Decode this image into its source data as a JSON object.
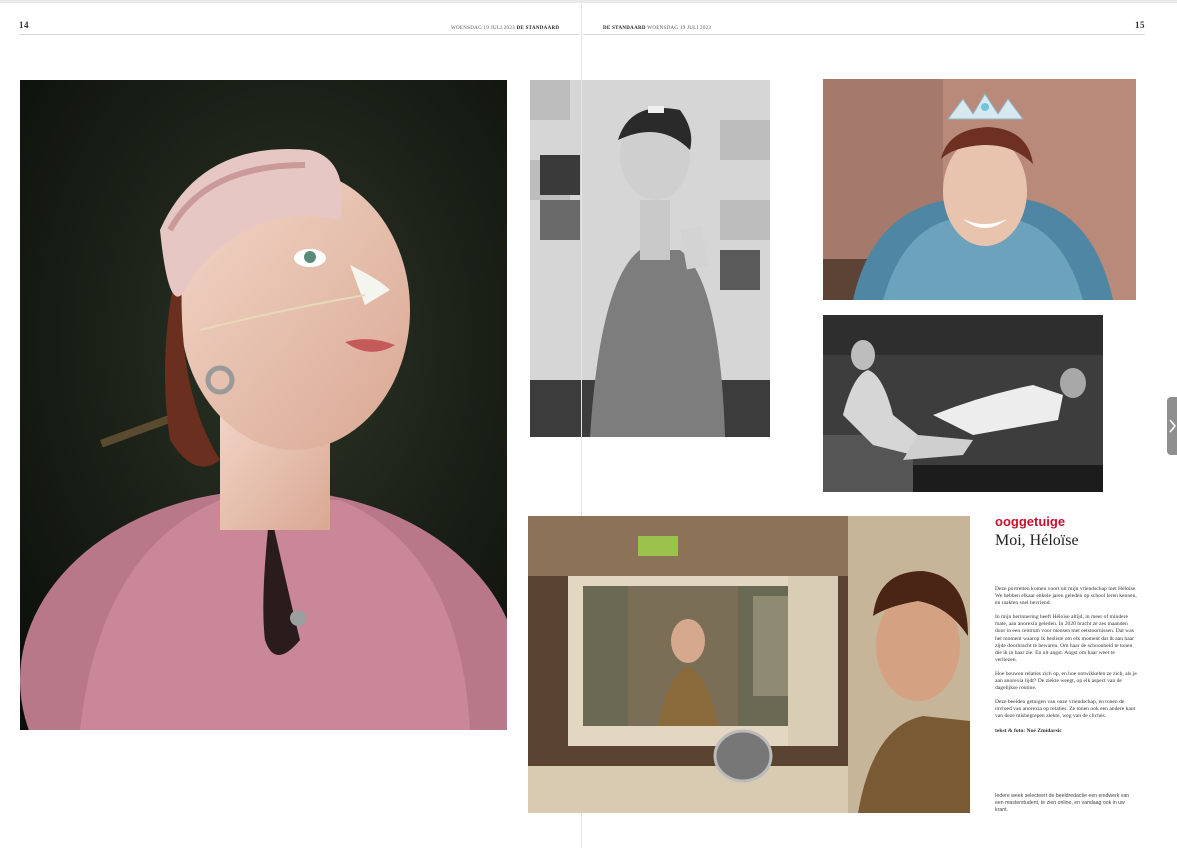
{
  "header": {
    "left_page_number": "14",
    "left_date": "WOENSDAG 19 JULI 2023",
    "left_brand": "DE STANDAARD",
    "right_brand": "DE STANDAARD",
    "right_date": "WOENSDAG 19 JULI 2023",
    "right_page_number": "15"
  },
  "article": {
    "kicker": "ooggetuige",
    "title": "Moi, Héloïse",
    "paragraphs": [
      "Deze portretten komen voort uit mijn vriendschap met Héloïse. We hebben elkaar enkele jaren geleden op school leren kennen, en raakten snel bevriend.",
      "In mijn herinnering heeft Héloïse altijd, in meer of mindere mate, aan anorexia geleden. In 2020 bracht ze zes maanden door in een centrum voor mensen met eetstoornissen. Dat was het moment waarop ik besliste om elk moment dat ik aan haar zijde doorbracht te bewaren. Om haar de schoonheid te tonen die ik in haar zie. En uit angst. Angst om haar weer te verliezen.",
      "Hoe bouwen relaties zich op, en hoe ontwikkelen ze zich, als je aan anorexia lijdt? De ziekte weegt, op elk aspect van de dagelijkse routine.",
      "Deze beelden getuigen van onze vriendschap, en tonen de invloed van anorexia op relaties. Ze tonen ook een andere kant van deze misbegrepen ziekte, weg van de clichés."
    ],
    "credit": "tekst & foto: Noé Zmidarsic",
    "note": "Iedere week selecteert de beeldredactie een eindwerk van een masterstudent, te zien online, en vandaag ook in uw krant."
  },
  "photos": {
    "large_portrait": "portrait-nasal-tube",
    "bw_portrait": "bw-portrait-tiled-wall",
    "tiara_portrait": "portrait-tiara-fur",
    "bw_couch": "bw-friends-on-couch",
    "mirror_bathroom": "bathroom-mirror-scene"
  },
  "colors": {
    "accent": "#c8102e",
    "side_tab": "#8f8f8f"
  },
  "icons": {
    "side_tab_icon": "chevron-right-icon"
  }
}
